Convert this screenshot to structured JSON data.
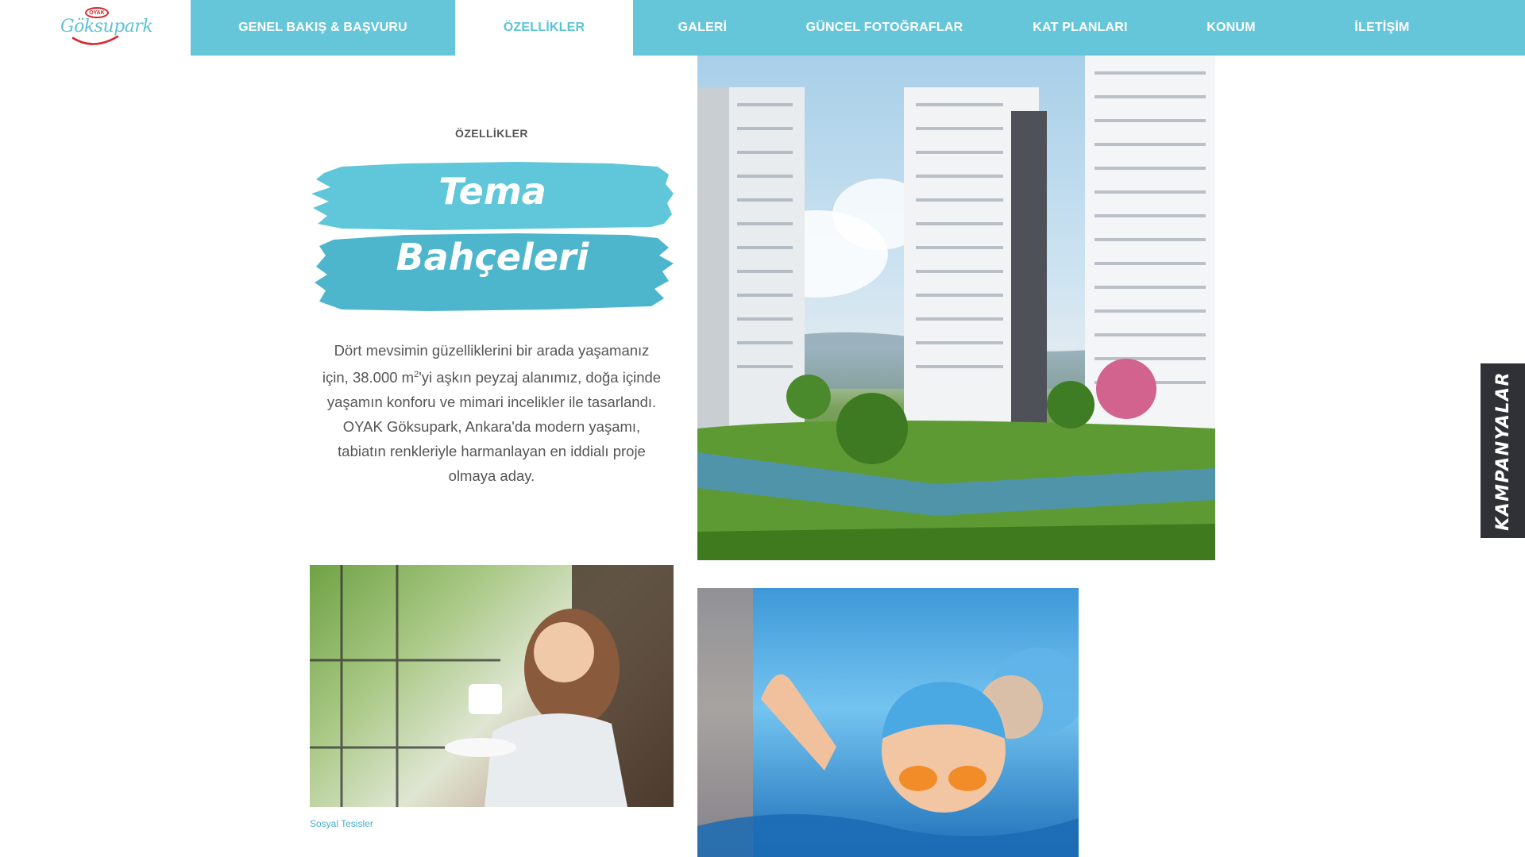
{
  "brand": {
    "logo_badge": "OYAK",
    "logo_text": "Göksupark",
    "logo_color": "#5cc3d6",
    "badge_color": "#d7262c"
  },
  "nav": {
    "items": [
      {
        "label": "GENEL BAKIŞ & BAŞVURU",
        "active": false
      },
      {
        "label": "ÖZELLİKLER",
        "active": true
      },
      {
        "label": "GALERİ",
        "active": false
      },
      {
        "label": "GÜNCEL FOTOĞRAFLAR",
        "active": false
      },
      {
        "label": "KAT PLANLARI",
        "active": false
      },
      {
        "label": "KONUM",
        "active": false
      },
      {
        "label": "İLETİŞİM",
        "active": false
      }
    ],
    "bar_color": "#66c6d9"
  },
  "feature": {
    "section_label": "ÖZELLİKLER",
    "title_line1": "Tema",
    "title_line2": "Bahçeleri",
    "desc_part1": "Dört mevsimin güzelliklerini bir arada yaşamanız için, 38.000 m",
    "desc_sup": "2",
    "desc_part2": "'yi aşkın peyzaj alanımız, doğa içinde yaşamın konforu ve mimari incelikler ile tasarlandı. OYAK Göksupark, Ankara'da modern yaşamı, tabiatın renkleriyle harmanlayan en iddialı proje olmaya aday.",
    "brush_color_top": "#5fc7d9",
    "brush_color_bottom": "#4eb6cc"
  },
  "gallery": {
    "caption": "Sosyal Tesisler"
  },
  "side_tab": {
    "label": "KAMPANYALAR",
    "color": "#2f3136"
  }
}
